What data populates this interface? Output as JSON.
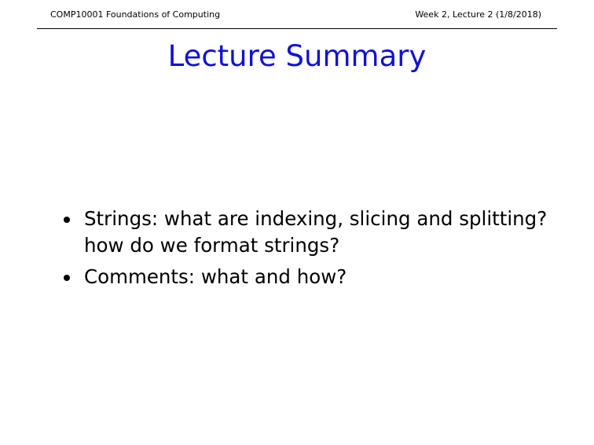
{
  "header": {
    "left": "COMP10001 Foundations of Computing",
    "right": "Week 2, Lecture 2 (1/8/2018)"
  },
  "title": "Lecture Summary",
  "bullets": [
    "Strings: what are indexing, slicing and splitting? how do we format strings?",
    "Comments: what and how?"
  ],
  "colors": {
    "title": "#1010d8",
    "text": "#000000",
    "background": "#ffffff"
  }
}
